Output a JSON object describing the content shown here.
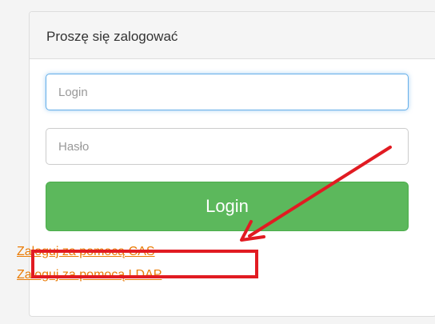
{
  "panel": {
    "title": "Proszę się zalogować"
  },
  "form": {
    "login_placeholder": "Login",
    "password_placeholder": "Hasło",
    "login_value": "",
    "password_value": "",
    "submit_label": "Login"
  },
  "links": {
    "cas_label": "Zaloguj za pomocą CAS",
    "ldap_label": "Zaloguj za pomocą LDAP"
  },
  "colors": {
    "submit_button": "#5cb85c",
    "link": "#ea7c06",
    "annotation": "#e11b22",
    "focus_border": "#66afe9"
  },
  "annotation": {
    "highlighted_item": "cas_label",
    "marker": "red-arrow-and-box"
  }
}
